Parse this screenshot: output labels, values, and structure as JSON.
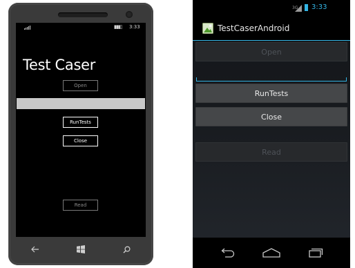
{
  "windows_phone": {
    "status": {
      "time": "3:33"
    },
    "title": "Test Caser",
    "buttons": {
      "open": "Open",
      "run_tests": "RunTests",
      "close": "Close",
      "read": "Read"
    },
    "text_field": {
      "value": "",
      "placeholder": ""
    },
    "navbar": {
      "back_icon": "back-arrow-icon",
      "start_icon": "windows-logo-icon",
      "search_icon": "search-icon"
    },
    "colors": {
      "background": "#000000",
      "foreground": "#ffffff",
      "textbox": "#c8c8c8",
      "disabled": "#8a8a8a"
    }
  },
  "android": {
    "status": {
      "network": "3G",
      "time": "3:33"
    },
    "app_title": "TestCaserAndroid",
    "buttons": {
      "open": "Open",
      "run_tests": "RunTests",
      "close": "Close",
      "read": "Read"
    },
    "edit_field": {
      "value": "",
      "placeholder": ""
    },
    "navbar": {
      "back_icon": "back-icon",
      "home_icon": "home-icon",
      "recents_icon": "recent-apps-icon"
    },
    "colors": {
      "accent": "#33b5e5",
      "button": "#454749",
      "button_disabled": "#27292c"
    }
  }
}
